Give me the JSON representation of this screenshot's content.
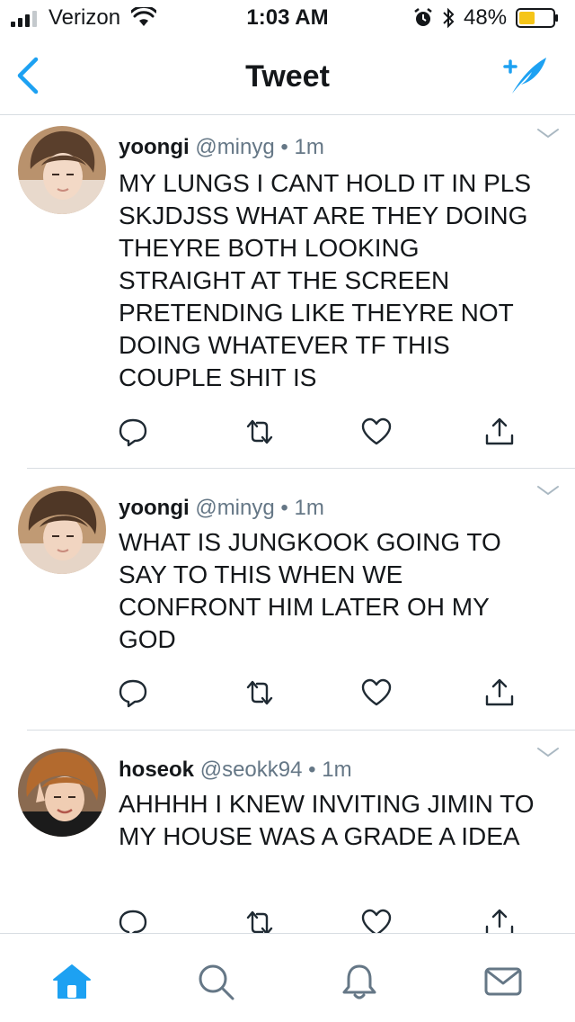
{
  "status_bar": {
    "carrier": "Verizon",
    "time": "1:03 AM",
    "battery_percent": "48%",
    "battery_level": 0.48,
    "icons": [
      "signal-icon",
      "wifi-icon",
      "alarm-icon",
      "bluetooth-icon",
      "battery-icon"
    ]
  },
  "nav": {
    "title": "Tweet",
    "back_icon": "back-chevron-icon",
    "compose_icon": "compose-tweet-icon"
  },
  "colors": {
    "accent": "#1da1f2",
    "text": "#14171a",
    "secondary": "#657786",
    "divider": "#d8dde2",
    "battery_fill": "#f5c518"
  },
  "tweets": [
    {
      "name": "yoongi",
      "handle": "@minyg",
      "dot": "•",
      "ago": "1m",
      "text": "MY LUNGS I CANT HOLD IT IN PLS SKJDJSS WHAT ARE THEY DOING THEYRE BOTH LOOKING STRAIGHT AT THE SCREEN PRETENDING LIKE THEYRE NOT DOING WHATEVER TF THIS COUPLE SHIT IS"
    },
    {
      "name": "yoongi",
      "handle": "@minyg",
      "dot": "•",
      "ago": "1m",
      "text": "WHAT IS JUNGKOOK GOING TO SAY TO THIS WHEN WE CONFRONT HIM LATER OH MY GOD"
    },
    {
      "name": "hoseok",
      "handle": "@seokk94",
      "dot": "•",
      "ago": "1m",
      "text": "AHHHH I KNEW INVITING JIMIN TO MY HOUSE WAS A GRADE A IDEA"
    }
  ],
  "tweet_actions": [
    "reply-icon",
    "retweet-icon",
    "like-icon",
    "share-icon"
  ],
  "tab_bar": {
    "tabs": [
      "home-tab",
      "search-tab",
      "notifications-tab",
      "messages-tab"
    ],
    "active": "home-tab"
  }
}
